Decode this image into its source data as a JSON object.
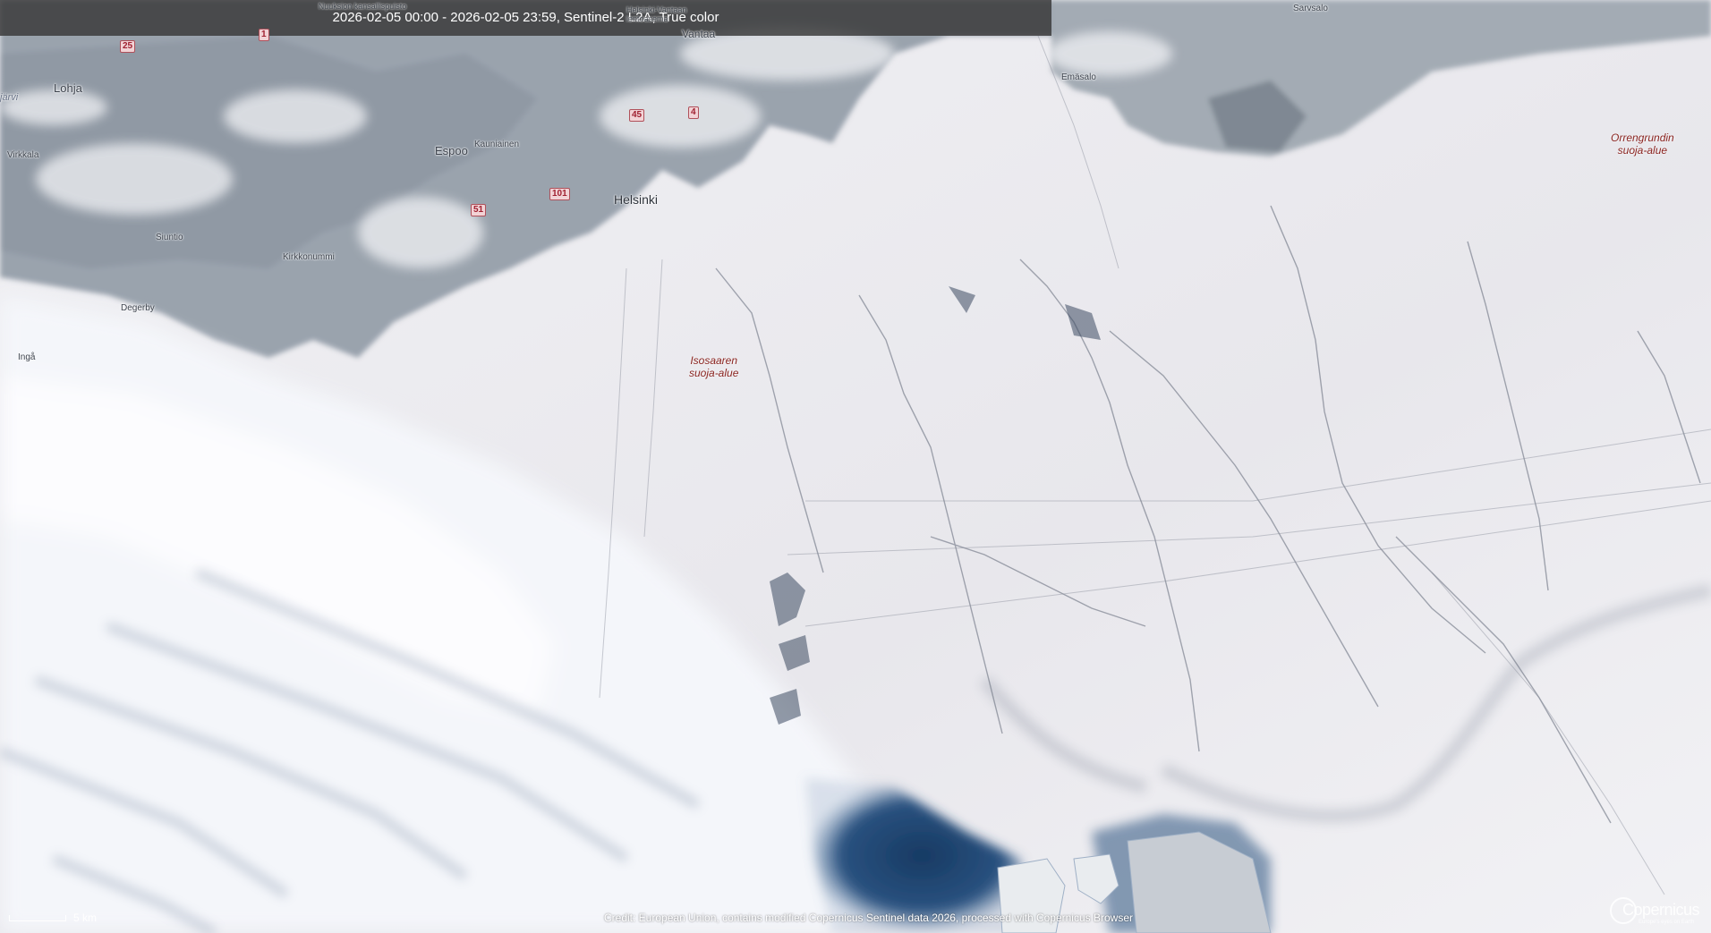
{
  "header": {
    "title": "2026-02-05 00:00 - 2026-02-05 23:59, Sentinel-2 L2A, True color"
  },
  "places": {
    "lohja": "Lohja",
    "espoo": "Espoo",
    "kauniainen": "Kauniainen",
    "helsinki": "Helsinki",
    "vantaa": "Vantaa",
    "virkkala": "Virkkala",
    "siuntio": "Siuntio",
    "kirkkonummi": "Kirkkonummi",
    "degerby": "Degerby",
    "inga": "Ingå",
    "emasalo": "Emäsalo",
    "sarvsalo": "Sarvsalo",
    "jarvi": "järvi",
    "nuuksio": "Nuuksion kansallispuisto",
    "helsinki_vantaa": "Helsinki-Vantaan lentoasema"
  },
  "protected_areas": {
    "isosaari": [
      "Isosaaren",
      "suoja-alue"
    ],
    "orrengrund": [
      "Orrengrundin",
      "suoja-alue"
    ]
  },
  "roads": {
    "r25": "25",
    "r1": "1",
    "r45": "45",
    "r4": "4",
    "r101": "101",
    "r51": "51"
  },
  "scale": {
    "label": "5 km"
  },
  "credit": "Credit: European Union, contains modified Copernicus Sentinel data 2026, processed with Copernicus Browser",
  "logo": {
    "name": "Copernicus",
    "tagline": "Europe's eyes on Earth"
  },
  "colors": {
    "sea_ice": "#ecebef",
    "open_water": "#1f3f66",
    "land": "#9aa3ad",
    "cloud": "#f4f6fa",
    "protected_area_label": "#8a2420",
    "header_bg": "#373737"
  }
}
